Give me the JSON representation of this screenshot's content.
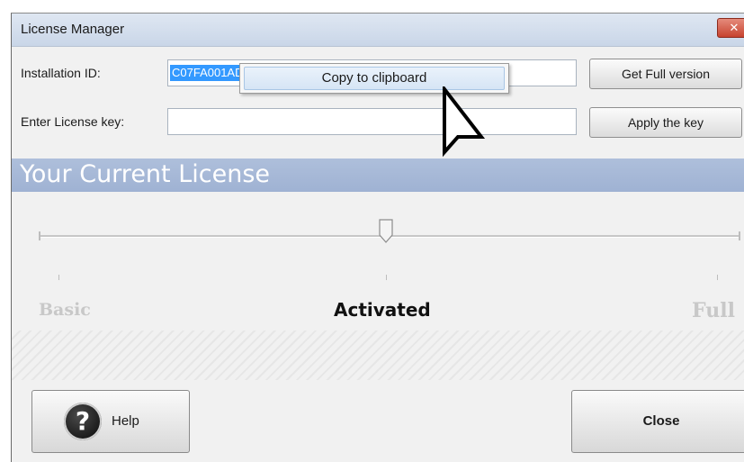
{
  "window": {
    "title": "License Manager",
    "close_glyph": "✕"
  },
  "form": {
    "installation_id_label": "Installation ID:",
    "installation_id_value": "C07FA001ADE21C5039A201114ADB73708CD031C5",
    "license_key_label": "Enter License key:",
    "license_key_value": "",
    "get_full_label": "Get Full version",
    "apply_key_label": "Apply the key"
  },
  "context_menu": {
    "items": [
      {
        "label": "Copy to clipboard"
      }
    ]
  },
  "license": {
    "section_title": "Your Current License",
    "stages": {
      "basic": "Basic",
      "current": "Activated",
      "full": "Full"
    },
    "slider_position": 0.5
  },
  "footer": {
    "help_label": "Help",
    "close_label": "Close"
  },
  "icons": {
    "help": "question-circle-icon",
    "cursor": "mouse-pointer-icon",
    "close": "close-icon"
  },
  "colors": {
    "accent": "#9fb2d3",
    "selection": "#3399ff",
    "close_button": "#c7432f"
  }
}
